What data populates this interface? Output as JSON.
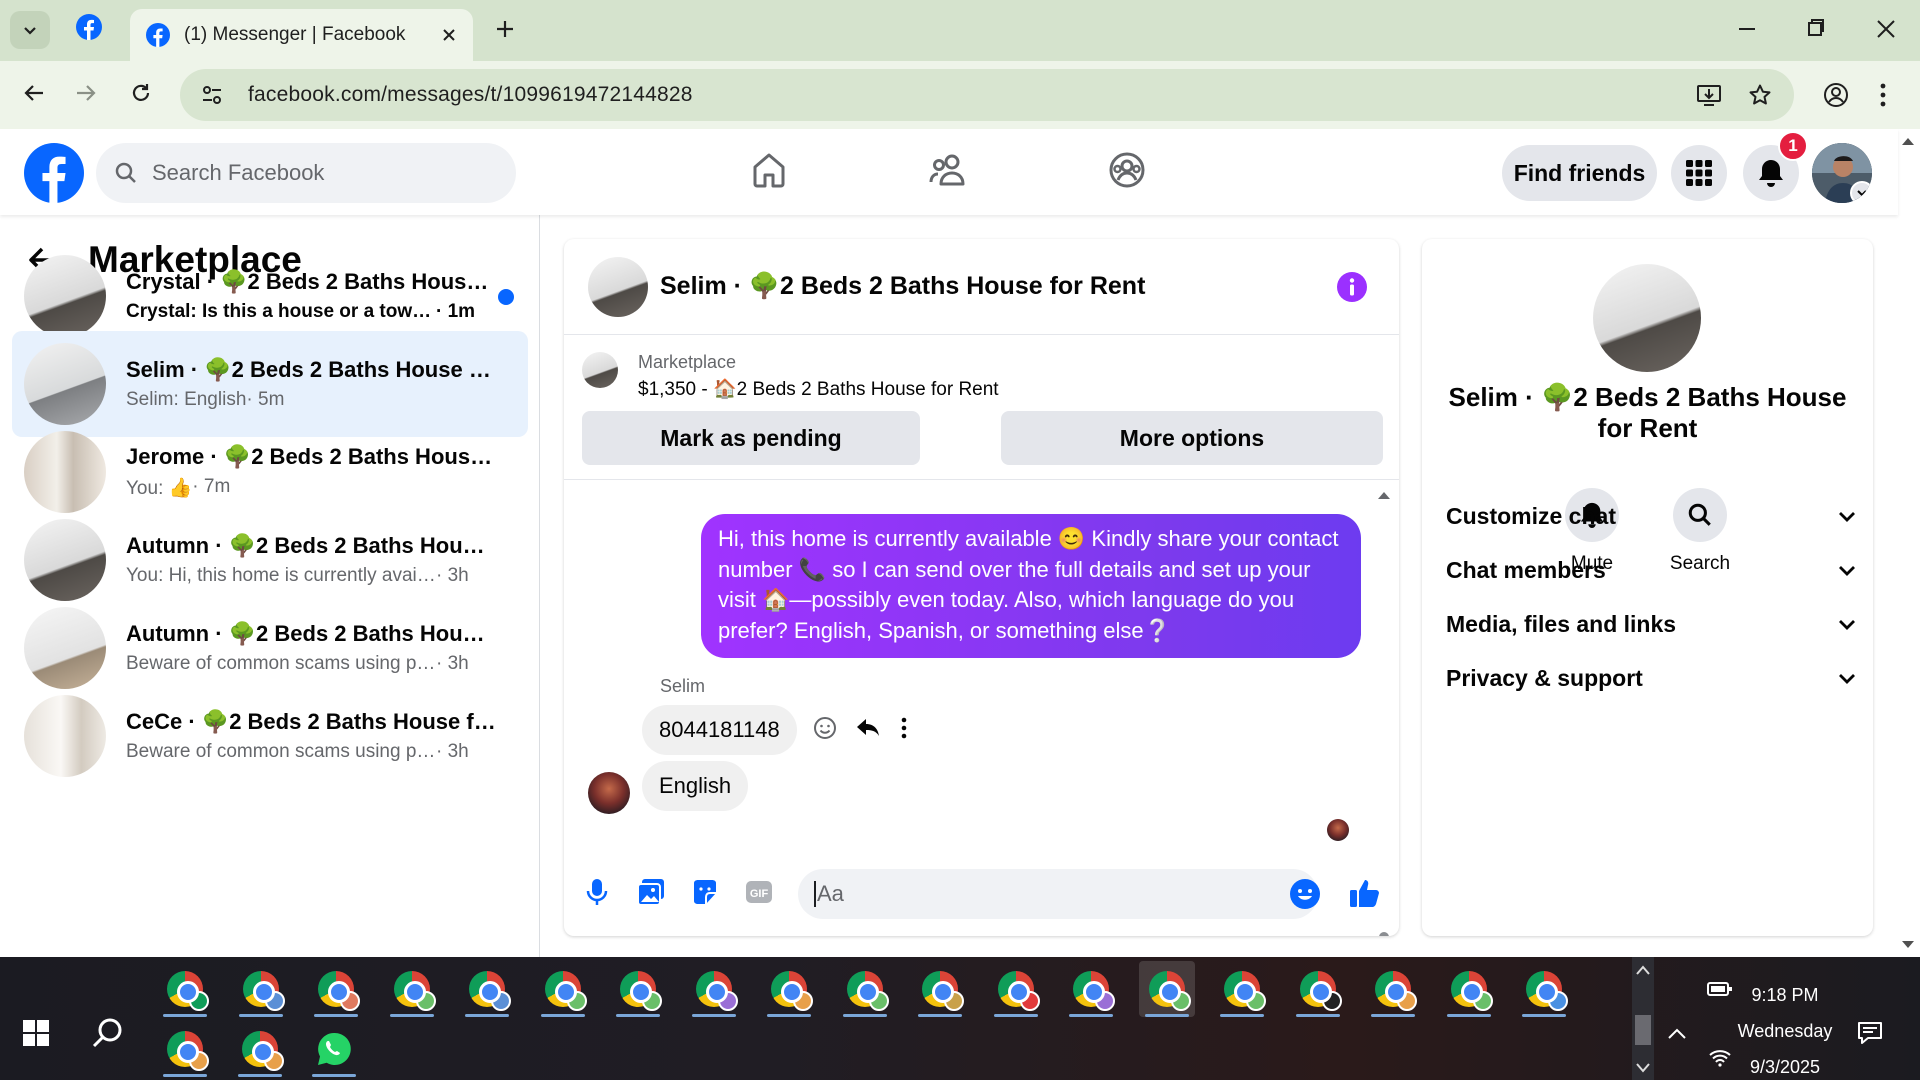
{
  "browser": {
    "tab_title": "(1) Messenger | Facebook",
    "url": "facebook.com/messages/t/1099619472144828"
  },
  "fb": {
    "search_placeholder": "Search Facebook",
    "find_friends": "Find friends",
    "notification_count": "1"
  },
  "sidebar": {
    "title": "Marketplace",
    "conversations": [
      {
        "name": "Crystal · 🌳2 Beds 2 Baths House...",
        "preview": "Crystal: Is this a house or a townh...",
        "time": " · 1m",
        "unread": true
      },
      {
        "name": "Selim · 🌳2 Beds 2 Baths House fo...",
        "preview": "Selim: English",
        "time": " · 5m",
        "unread": false
      },
      {
        "name": "Jerome · 🌳2 Beds 2 Baths House f...",
        "preview": "You: 👍",
        "time": " · 7m",
        "unread": false
      },
      {
        "name": "Autumn · 🌳2 Beds 2 Baths House ...",
        "preview": "You: Hi, this home is currently availabl...",
        "time": " · 3h",
        "unread": false
      },
      {
        "name": "Autumn · 🌳2 Beds 2 Baths House ...",
        "preview": "Beware of common scams using pay...",
        "time": " · 3h",
        "unread": false
      },
      {
        "name": "CeCe · 🌳2 Beds 2 Baths House for...",
        "preview": "Beware of common scams using pay...",
        "time": " · 3h",
        "unread": false
      }
    ]
  },
  "chat": {
    "title": "Selim · 🌳2 Beds 2 Baths House for Rent",
    "listing_source": "Marketplace",
    "listing_line": "$1,350 - 🏠2 Beds 2 Baths House for Rent",
    "mark_pending": "Mark as pending",
    "more_options": "More options",
    "outgoing_message": "Hi, this home is currently available 😊 Kindly share your contact number 📞 so I can send over the full details and set up your visit 🏠—possibly even today. Also, which language do you prefer? English, Spanish, or something else❔",
    "sender_name": "Selim",
    "incoming_1": "8044181148",
    "incoming_2": "English",
    "input_placeholder": "Aa"
  },
  "details": {
    "title": "Selim · 🌳2 Beds 2 Baths House for Rent",
    "mute": "Mute",
    "search": "Search",
    "sections": [
      "Customize chat",
      "Chat members",
      "Media, files and links",
      "Privacy & support"
    ]
  },
  "taskbar": {
    "time": "9:18 PM",
    "day": "Wednesday",
    "date": "9/3/2025"
  },
  "colors": {
    "fb_blue": "#0866ff",
    "bubble_purple": "#8b3cf7",
    "selected_row": "#e7f1fd"
  }
}
